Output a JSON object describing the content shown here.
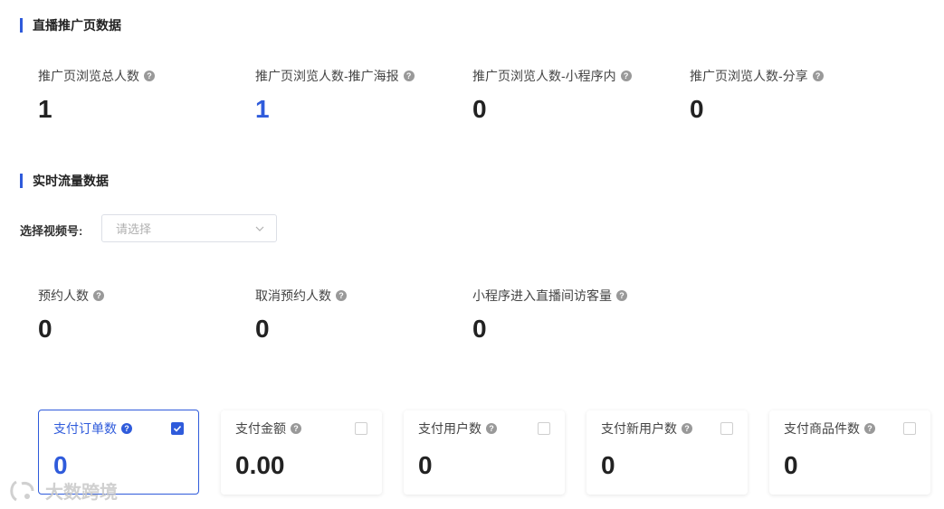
{
  "section1": {
    "title": "直播推广页数据",
    "stats": [
      {
        "label": "推广页浏览总人数",
        "value": "1"
      },
      {
        "label": "推广页浏览人数-推广海报",
        "value": "1"
      },
      {
        "label": "推广页浏览人数-小程序内",
        "value": "0"
      },
      {
        "label": "推广页浏览人数-分享",
        "value": "0"
      }
    ]
  },
  "section2": {
    "title": "实时流量数据",
    "select": {
      "label": "选择视频号:",
      "placeholder": "请选择"
    },
    "stats": [
      {
        "label": "预约人数",
        "value": "0"
      },
      {
        "label": "取消预约人数",
        "value": "0"
      },
      {
        "label": "小程序进入直播间访客量",
        "value": "0"
      }
    ]
  },
  "cards": [
    {
      "label": "支付订单数",
      "value": "0",
      "checked": true
    },
    {
      "label": "支付金额",
      "value": "0.00",
      "checked": false
    },
    {
      "label": "支付用户数",
      "value": "0",
      "checked": false
    },
    {
      "label": "支付新用户数",
      "value": "0",
      "checked": false
    },
    {
      "label": "支付商品件数",
      "value": "0",
      "checked": false
    }
  ],
  "help_glyph": "?",
  "icons": {
    "help": "question-circle-icon",
    "dropdown": "chevron-down-icon",
    "check": "check-icon"
  },
  "colors": {
    "accent": "#2f5bdb",
    "text": "#222222",
    "muted": "#999999"
  },
  "watermark": "大数跨境"
}
